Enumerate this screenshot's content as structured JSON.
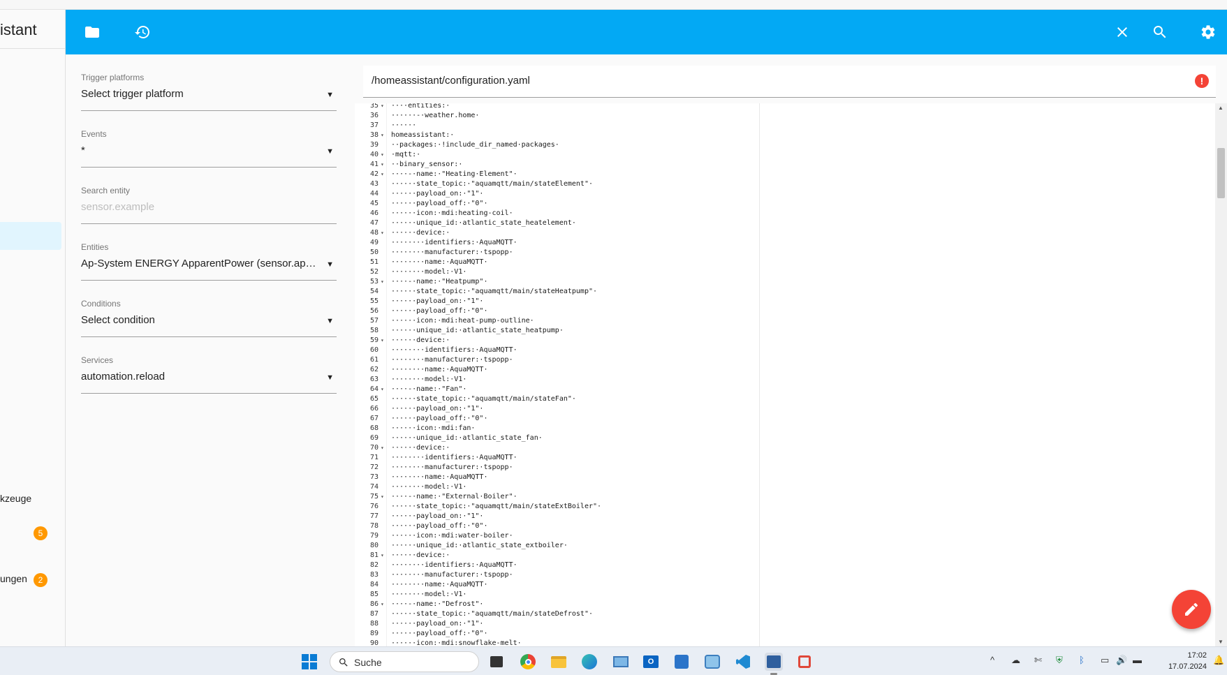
{
  "sidebar": {
    "title": "istant",
    "items": [
      {
        "label": "kzeuge",
        "badge": ""
      },
      {
        "label": "",
        "badge": "5"
      },
      {
        "label": "ungen",
        "badge": "2"
      }
    ]
  },
  "toolbar": {
    "icons": [
      "folder-icon",
      "history-icon",
      "close-icon",
      "search-icon",
      "settings-icon"
    ]
  },
  "panel": {
    "fields": [
      {
        "label": "Trigger platforms",
        "value": "Select trigger platform",
        "placeholder": false
      },
      {
        "label": "Events",
        "value": "*",
        "placeholder": false
      },
      {
        "label": "Search entity",
        "value": "sensor.example",
        "placeholder": true
      },
      {
        "label": "Entities",
        "value": "Ap-System ENERGY ApparentPower (sensor.ap_system_energy_apparentpower)",
        "placeholder": false
      },
      {
        "label": "Conditions",
        "value": "Select condition",
        "placeholder": false
      },
      {
        "label": "Services",
        "value": "automation.reload",
        "placeholder": false
      }
    ]
  },
  "editor": {
    "path": "/homeassistant/configuration.yaml",
    "error_icon": "!",
    "lines": [
      {
        "n": "35",
        "f": true,
        "t": "····entities:·"
      },
      {
        "n": "36",
        "f": false,
        "t": "······-·weather.home·"
      },
      {
        "n": "37",
        "f": false,
        "t": "······"
      },
      {
        "n": "38",
        "f": true,
        "t": "homeassistant:·"
      },
      {
        "n": "39",
        "f": false,
        "t": "··packages:·!include_dir_named·packages·"
      },
      {
        "n": "40",
        "f": true,
        "t": "·mqtt:·"
      },
      {
        "n": "41",
        "f": true,
        "t": "··binary_sensor:·"
      },
      {
        "n": "42",
        "f": true,
        "t": "····-·name:·\"Heating·Element\"·"
      },
      {
        "n": "43",
        "f": false,
        "t": "······state_topic:·\"aquamqtt/main/stateElement\"·"
      },
      {
        "n": "44",
        "f": false,
        "t": "······payload_on:·\"1\"·"
      },
      {
        "n": "45",
        "f": false,
        "t": "······payload_off:·\"0\"·"
      },
      {
        "n": "46",
        "f": false,
        "t": "······icon:·mdi:heating-coil·"
      },
      {
        "n": "47",
        "f": false,
        "t": "······unique_id:·atlantic_state_heatelement·"
      },
      {
        "n": "48",
        "f": true,
        "t": "······device:·"
      },
      {
        "n": "49",
        "f": false,
        "t": "········identifiers:·AquaMQTT·"
      },
      {
        "n": "50",
        "f": false,
        "t": "········manufacturer:·tspopp·"
      },
      {
        "n": "51",
        "f": false,
        "t": "········name:·AquaMQTT·"
      },
      {
        "n": "52",
        "f": false,
        "t": "········model:·V1·"
      },
      {
        "n": "53",
        "f": true,
        "t": "····-·name:·\"Heatpump\"·"
      },
      {
        "n": "54",
        "f": false,
        "t": "······state_topic:·\"aquamqtt/main/stateHeatpump\"·"
      },
      {
        "n": "55",
        "f": false,
        "t": "······payload_on:·\"1\"·"
      },
      {
        "n": "56",
        "f": false,
        "t": "······payload_off:·\"0\"·"
      },
      {
        "n": "57",
        "f": false,
        "t": "······icon:·mdi:heat-pump-outline·"
      },
      {
        "n": "58",
        "f": false,
        "t": "······unique_id:·atlantic_state_heatpump·"
      },
      {
        "n": "59",
        "f": true,
        "t": "······device:·"
      },
      {
        "n": "60",
        "f": false,
        "t": "········identifiers:·AquaMQTT·"
      },
      {
        "n": "61",
        "f": false,
        "t": "········manufacturer:·tspopp·"
      },
      {
        "n": "62",
        "f": false,
        "t": "········name:·AquaMQTT·"
      },
      {
        "n": "63",
        "f": false,
        "t": "········model:·V1·"
      },
      {
        "n": "64",
        "f": true,
        "t": "····-·name:·\"Fan\"·"
      },
      {
        "n": "65",
        "f": false,
        "t": "······state_topic:·\"aquamqtt/main/stateFan\"·"
      },
      {
        "n": "66",
        "f": false,
        "t": "······payload_on:·\"1\"·"
      },
      {
        "n": "67",
        "f": false,
        "t": "······payload_off:·\"0\"·"
      },
      {
        "n": "68",
        "f": false,
        "t": "······icon:·mdi:fan·"
      },
      {
        "n": "69",
        "f": false,
        "t": "······unique_id:·atlantic_state_fan·"
      },
      {
        "n": "70",
        "f": true,
        "t": "······device:·"
      },
      {
        "n": "71",
        "f": false,
        "t": "········identifiers:·AquaMQTT·"
      },
      {
        "n": "72",
        "f": false,
        "t": "········manufacturer:·tspopp·"
      },
      {
        "n": "73",
        "f": false,
        "t": "········name:·AquaMQTT·"
      },
      {
        "n": "74",
        "f": false,
        "t": "········model:·V1·"
      },
      {
        "n": "75",
        "f": true,
        "t": "····-·name:·\"External·Boiler\"·"
      },
      {
        "n": "76",
        "f": false,
        "t": "······state_topic:·\"aquamqtt/main/stateExtBoiler\"·"
      },
      {
        "n": "77",
        "f": false,
        "t": "······payload_on:·\"1\"·"
      },
      {
        "n": "78",
        "f": false,
        "t": "······payload_off:·\"0\"·"
      },
      {
        "n": "79",
        "f": false,
        "t": "······icon:·mdi:water-boiler·"
      },
      {
        "n": "80",
        "f": false,
        "t": "······unique_id:·atlantic_state_extboiler·"
      },
      {
        "n": "81",
        "f": true,
        "t": "······device:·"
      },
      {
        "n": "82",
        "f": false,
        "t": "········identifiers:·AquaMQTT·"
      },
      {
        "n": "83",
        "f": false,
        "t": "········manufacturer:·tspopp·"
      },
      {
        "n": "84",
        "f": false,
        "t": "········name:·AquaMQTT·"
      },
      {
        "n": "85",
        "f": false,
        "t": "········model:·V1·"
      },
      {
        "n": "86",
        "f": true,
        "t": "····-·name:·\"Defrost\"·"
      },
      {
        "n": "87",
        "f": false,
        "t": "······state_topic:·\"aquamqtt/main/stateDefrost\"·"
      },
      {
        "n": "88",
        "f": false,
        "t": "······payload_on:·\"1\"·"
      },
      {
        "n": "89",
        "f": false,
        "t": "······payload_off:·\"0\"·"
      },
      {
        "n": "90",
        "f": false,
        "t": "······icon:·mdi:snowflake-melt·"
      }
    ]
  },
  "fab": {
    "icon": "pencil-icon"
  },
  "taskbar": {
    "search_label": "Suche",
    "time": "17:02",
    "date": "17.07.2024"
  },
  "colors": {
    "accent": "#03a9f4",
    "fab": "#f44336",
    "badge": "#ff9800"
  }
}
